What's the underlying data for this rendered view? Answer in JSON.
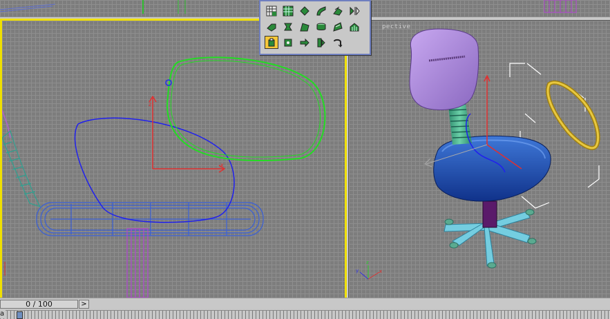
{
  "viewport_perspective": {
    "label": "pective"
  },
  "timeline": {
    "frame_display": "0 / 100",
    "next_symbol": ">"
  },
  "track": {
    "label": "a"
  },
  "toolbar": {
    "rows": [
      [
        "grid-select-icon",
        "grid-pattern-icon",
        "diamond-icon",
        "curve-icon",
        "bend-icon",
        "mirror-icon"
      ],
      [
        "fold-icon",
        "twist-icon",
        "taper-icon",
        "cylinder-icon",
        "shell-icon",
        "lattice-icon"
      ],
      [
        "select-object-icon",
        "pick-icon",
        "arrow-right-icon",
        "split-icon",
        "hook-icon"
      ]
    ]
  },
  "colors": {
    "active_viewport": "#f0e000",
    "toolbar_border": "#6f7fbf",
    "active_button": "#f6c838",
    "spline_green": "#22dd22",
    "spline_blue": "#2020ee",
    "wireframe_blue": "#3a5fd6",
    "axis_red": "#e03030"
  }
}
